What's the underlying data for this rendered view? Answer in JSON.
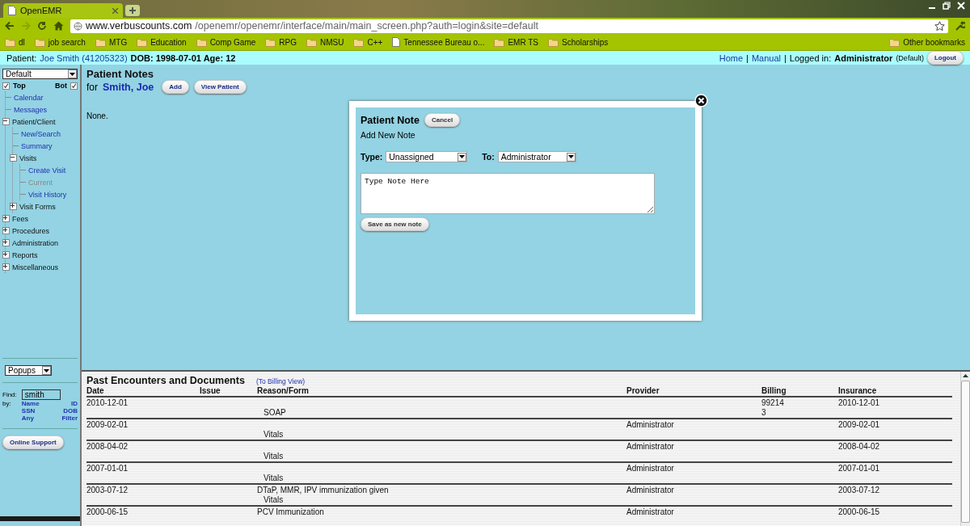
{
  "browser": {
    "tab_title": "OpenEMR",
    "url_host": "www.verbuscounts.com",
    "url_path": "/openemr/openemr/interface/main/main_screen.php?auth=login&site=default",
    "bookmarks": [
      {
        "label": "dl",
        "kind": "folder"
      },
      {
        "label": "job search",
        "kind": "folder"
      },
      {
        "label": "MTG",
        "kind": "folder"
      },
      {
        "label": "Education",
        "kind": "folder"
      },
      {
        "label": "Comp Game",
        "kind": "folder"
      },
      {
        "label": "RPG",
        "kind": "folder"
      },
      {
        "label": "NMSU",
        "kind": "folder"
      },
      {
        "label": "C++",
        "kind": "folder"
      },
      {
        "label": "Tennessee Bureau o...",
        "kind": "page"
      },
      {
        "label": "EMR TS",
        "kind": "folder"
      },
      {
        "label": "Scholarships",
        "kind": "folder"
      }
    ],
    "other_bookmarks": "Other bookmarks"
  },
  "patient_bar": {
    "label": "Patient:",
    "patient": "Joe Smith (41205323)",
    "dob": "DOB: 1998-07-01 Age: 12",
    "home": "Home",
    "separator_1": "|",
    "manual": "Manual",
    "separator_2": "|",
    "logged_in": "Logged in:",
    "user": "Administrator",
    "role": "(Default)",
    "logout": "Logout"
  },
  "nav": {
    "view_select": "Default",
    "top": {
      "label": "Top",
      "checked": true
    },
    "bot": {
      "label": "Bot",
      "checked": true
    },
    "items": [
      {
        "label": "Calendar",
        "kind": "link"
      },
      {
        "label": "Messages",
        "kind": "link"
      },
      {
        "label": "Patient/Client",
        "kind": "folder",
        "expanded": true,
        "children": [
          {
            "label": "New/Search",
            "kind": "link"
          },
          {
            "label": "Summary",
            "kind": "link"
          },
          {
            "label": "Visits",
            "kind": "folder",
            "expanded": true,
            "children": [
              {
                "label": "Create Visit",
                "kind": "link",
                "disabled": false
              },
              {
                "label": "Current",
                "kind": "link",
                "disabled": true
              },
              {
                "label": "Visit History",
                "kind": "link",
                "disabled": false
              }
            ]
          },
          {
            "label": "Visit Forms",
            "kind": "folder",
            "expanded": false
          }
        ]
      },
      {
        "label": "Fees",
        "kind": "folder",
        "expanded": false
      },
      {
        "label": "Procedures",
        "kind": "folder",
        "expanded": false
      },
      {
        "label": "Administration",
        "kind": "folder",
        "expanded": false
      },
      {
        "label": "Reports",
        "kind": "folder",
        "expanded": false
      },
      {
        "label": "Miscellaneous",
        "kind": "folder",
        "expanded": false
      }
    ],
    "popups_select": "Popups",
    "find_label": "Find:",
    "find_value": "smith",
    "by_label": "by:",
    "search_by": [
      "Name",
      "ID",
      "SSN",
      "DOB",
      "Any",
      "Filter"
    ],
    "online_support": "Online Support"
  },
  "notes": {
    "title": "Patient Notes",
    "for": "for",
    "patient": "Smith, Joe",
    "add": "Add",
    "view_patient": "View Patient",
    "empty": "None."
  },
  "dialog": {
    "title": "Patient Note",
    "cancel": "Cancel",
    "subtitle": "Add New Note",
    "type_label": "Type:",
    "type_value": "Unassigned",
    "to_label": "To:",
    "to_value": "Administrator",
    "note_value": "Type Note Here",
    "save": "Save as new note"
  },
  "encounters": {
    "title": "Past Encounters and Documents",
    "billing_view": "(To Billing View)",
    "columns": [
      "Date",
      "Issue",
      "Reason/Form",
      "Provider",
      "Billing",
      "Insurance"
    ],
    "rows": [
      {
        "date": "2010-12-01",
        "reason": "",
        "form": "SOAP",
        "provider": "",
        "billing": [
          "99214",
          "3"
        ],
        "insurance": "2010-12-01"
      },
      {
        "date": "2009-02-01",
        "reason": "",
        "form": "Vitals",
        "provider": "Administrator",
        "billing": [],
        "insurance": "2009-02-01"
      },
      {
        "date": "2008-04-02",
        "reason": "",
        "form": "Vitals",
        "provider": "Administrator",
        "billing": [],
        "insurance": "2008-04-02"
      },
      {
        "date": "2007-01-01",
        "reason": "",
        "form": "Vitals",
        "provider": "Administrator",
        "billing": [],
        "insurance": "2007-01-01"
      },
      {
        "date": "2003-07-12",
        "reason": "DTaP, MMR, IPV immunization given",
        "form": "Vitals",
        "provider": "Administrator",
        "billing": [],
        "insurance": "2003-07-12"
      },
      {
        "date": "2000-06-15",
        "reason": "PCV Immunization",
        "form": "",
        "provider": "Administrator",
        "billing": [],
        "insurance": "2000-06-15"
      }
    ]
  }
}
